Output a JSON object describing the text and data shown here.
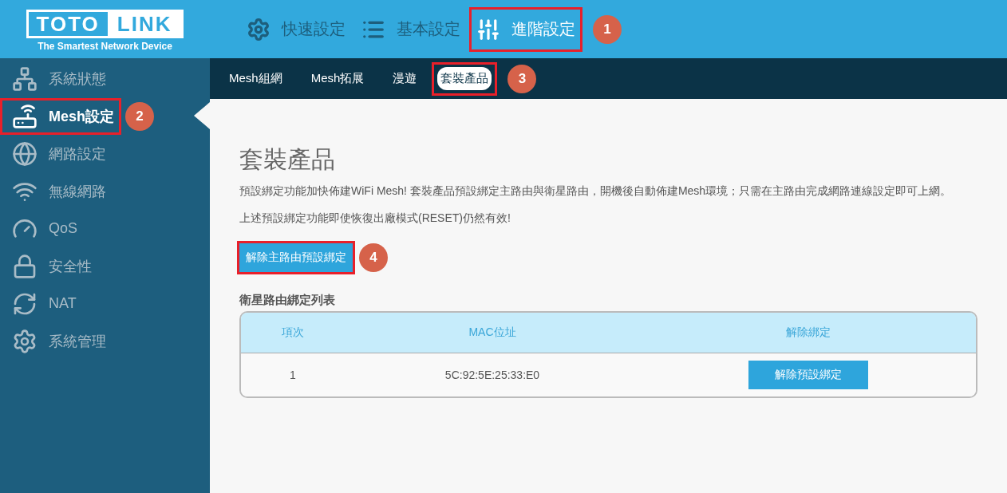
{
  "logo": {
    "word_1": "TOTO",
    "word_2": "LINK",
    "tagline": "The Smartest Network Device"
  },
  "top_nav": [
    {
      "label": "快速設定",
      "kind": "gear",
      "selected": false,
      "highlighted": false
    },
    {
      "label": "基本設定",
      "kind": "list",
      "selected": false,
      "highlighted": false
    },
    {
      "label": "進階設定",
      "kind": "sliders",
      "selected": true,
      "highlighted": true,
      "callout": "1"
    }
  ],
  "sidebar": {
    "items": [
      {
        "label": "系統狀態",
        "kind": "network",
        "selected": false,
        "highlighted": false
      },
      {
        "label": "Mesh設定",
        "kind": "router",
        "selected": true,
        "highlighted": true,
        "callout": "2"
      },
      {
        "label": "網路設定",
        "kind": "globe",
        "selected": false,
        "highlighted": false
      },
      {
        "label": "無線網路",
        "kind": "wifi",
        "selected": false,
        "highlighted": false
      },
      {
        "label": "QoS",
        "kind": "gauge",
        "selected": false,
        "highlighted": false
      },
      {
        "label": "安全性",
        "kind": "lock",
        "selected": false,
        "highlighted": false
      },
      {
        "label": "NAT",
        "kind": "refresh",
        "selected": false,
        "highlighted": false
      },
      {
        "label": "系統管理",
        "kind": "gear",
        "selected": false,
        "highlighted": false
      }
    ]
  },
  "tabs": [
    {
      "label": "Mesh組網",
      "selected": false,
      "highlighted": false
    },
    {
      "label": "Mesh拓展",
      "selected": false,
      "highlighted": false
    },
    {
      "label": "漫遊",
      "selected": false,
      "highlighted": false
    },
    {
      "label": "套裝產品",
      "selected": true,
      "highlighted": true,
      "callout": "3"
    }
  ],
  "content": {
    "title": "套裝產品",
    "paragraphs": [
      "預設綁定功能加快佈建WiFi Mesh! 套裝產品預設綁定主路由與衛星路由，開機後自動佈建Mesh環境；只需在主路由完成網路連線設定即可上網。",
      "上述預設綁定功能即使恢復出廠模式(RESET)仍然有效!"
    ],
    "unbind_button": {
      "label": "解除主路由預設綁定",
      "highlighted": true,
      "callout": "4"
    },
    "table_title": "衛星路由綁定列表",
    "table": {
      "columns": [
        "項次",
        "MAC位址",
        "解除綁定"
      ],
      "rows": [
        {
          "index": "1",
          "mac": "5C:92:5E:25:33:E0",
          "action": "解除預設綁定"
        }
      ]
    }
  }
}
